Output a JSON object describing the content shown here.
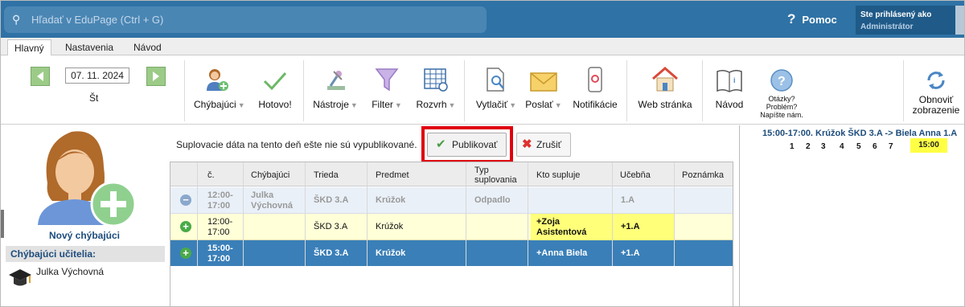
{
  "topbar": {
    "search_placeholder": "Hľadať v EduPage (Ctrl + G)",
    "help_label": "Pomoc",
    "user_label": "Ste prihlásený ako",
    "user_role": "Administrátor"
  },
  "tabs": [
    "Hlavný",
    "Nastavenia",
    "Návod"
  ],
  "date": {
    "value": "07. 11. 2024",
    "day": "Št"
  },
  "ribbon": {
    "chybajuci": "Chýbajúci",
    "hotovo": "Hotovo!",
    "nastroje": "Nástroje",
    "filter": "Filter",
    "rozvrh": "Rozvrh",
    "vytlacit": "Vytlačiť",
    "poslat": "Poslať",
    "notifikacie": "Notifikácie",
    "web": "Web stránka",
    "navod": "Návod",
    "otazky1": "Otázky?",
    "otazky2": "Problém?",
    "otazky3": "Napíšte nám.",
    "obnovit1": "Obnoviť",
    "obnovit2": "zobrazenie"
  },
  "left": {
    "new_missing": "Nový chýbajúci",
    "missing_header": "Chýbajúci učitelia:",
    "teacher": "Julka Výchovná"
  },
  "notice": "Suplovacie dáta na tento deň ešte nie sú vypublikované.",
  "buttons": {
    "publish": "Publikovať",
    "cancel": "Zrušiť"
  },
  "table": {
    "headers": [
      "č.",
      "Chýbajúci",
      "Trieda",
      "Predmet",
      "Typ suplovania",
      "Kto supluje",
      "Učebňa",
      "Poznámka"
    ],
    "rows": [
      {
        "num": "12:00-\n17:00",
        "missing": "Julka\nVýchovná",
        "class": "ŠKD 3.A",
        "subject": "Krúžok",
        "type": "Odpadlo",
        "sub": "",
        "room": "1.A",
        "note": ""
      },
      {
        "num": "12:00-\n17:00",
        "missing": "",
        "class": "ŠKD 3.A",
        "subject": "Krúžok",
        "type": "",
        "sub": "+Zoja\nAsistentová",
        "room": "+1.A",
        "note": ""
      },
      {
        "num": "15:00-\n17:00",
        "missing": "",
        "class": "ŠKD 3.A",
        "subject": "Krúžok",
        "type": "",
        "sub": "+Anna Biela",
        "room": "+1.A",
        "note": ""
      }
    ]
  },
  "right": {
    "title": "15:00-17:00. Krúžok ŠKD 3.A -> Biela Anna 1.A",
    "periods": [
      "1",
      "2",
      "3",
      "4",
      "5",
      "6",
      "7"
    ],
    "highlight": "15:00"
  }
}
